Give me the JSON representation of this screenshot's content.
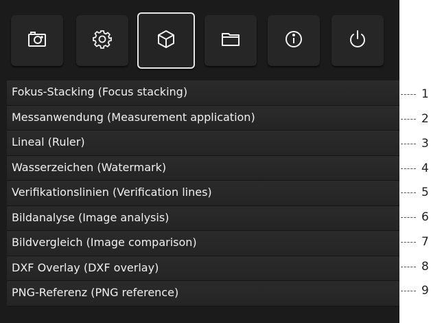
{
  "toolbar": {
    "buttons": [
      {
        "icon": "camera-icon"
      },
      {
        "icon": "gear-icon"
      },
      {
        "icon": "cube-icon",
        "active": true
      },
      {
        "icon": "folder-icon"
      },
      {
        "icon": "info-icon"
      },
      {
        "icon": "power-icon"
      }
    ],
    "active_border_color": "#e6e6e6"
  },
  "menu": {
    "items": [
      {
        "label": "Fokus-Stacking (Focus stacking)",
        "callout": "1"
      },
      {
        "label": "Messanwendung (Measurement application)",
        "callout": "2"
      },
      {
        "label": "Lineal (Ruler)",
        "callout": "3"
      },
      {
        "label": "Wasserzeichen (Watermark)",
        "callout": "4"
      },
      {
        "label": "Verifikationslinien (Verification lines)",
        "callout": "5"
      },
      {
        "label": "Bildanalyse (Image analysis)",
        "callout": "6"
      },
      {
        "label": "Bildvergleich (Image comparison)",
        "callout": "7"
      },
      {
        "label": "DXF Overlay (DXF overlay)",
        "callout": "8"
      },
      {
        "label": "PNG-Referenz (PNG reference)",
        "callout": "9"
      }
    ]
  },
  "colors": {
    "panel_bg": "#1b1b1b",
    "item_text": "#f0f0f0",
    "callout_text": "#222222"
  }
}
